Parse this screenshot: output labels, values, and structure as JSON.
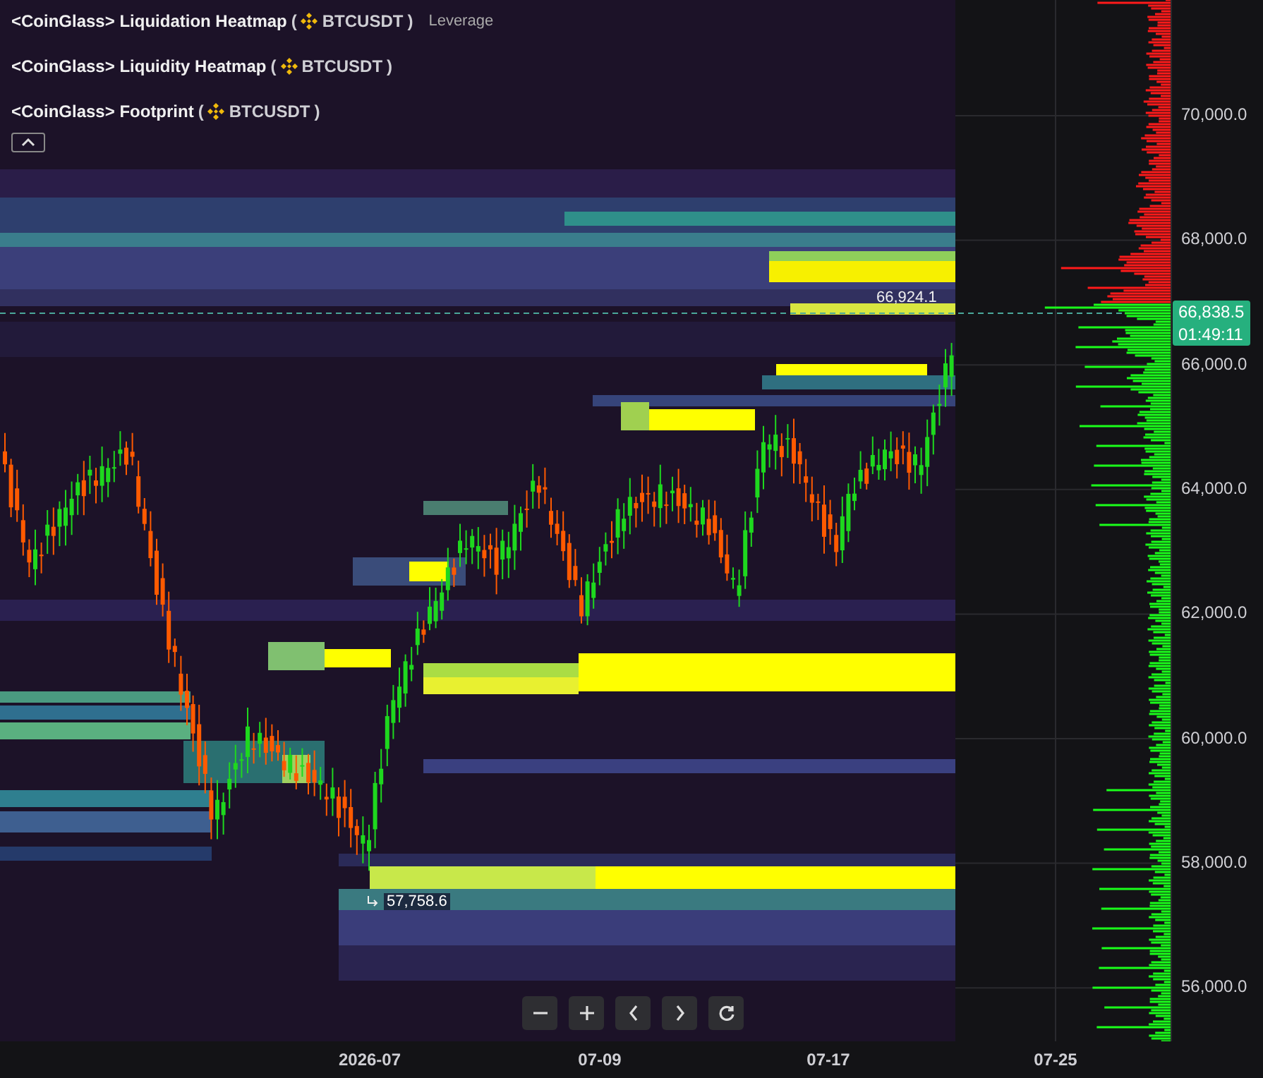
{
  "legend": [
    {
      "prefix": "<CoinGlass>",
      "title": "Liquidation Heatmap",
      "open_paren": "(",
      "symbol": "BTCUSDT",
      "close_paren": ")",
      "extra": "Leverage"
    },
    {
      "prefix": "<CoinGlass>",
      "title": "Liquidity Heatmap",
      "open_paren": "(",
      "symbol": "BTCUSDT",
      "close_paren": ")"
    },
    {
      "prefix": "<CoinGlass>",
      "title": "Footprint",
      "open_paren": "(",
      "symbol": "BTCUSDT",
      "close_paren": ")"
    }
  ],
  "price_axis": [
    "70,000.0",
    "68,000.0",
    "66,000.0",
    "64,000.0",
    "62,000.0",
    "60,000.0",
    "58,000.0",
    "56,000.0"
  ],
  "last_price": "66,838.5",
  "countdown": "01:49:11",
  "high_marker": "66,924.1",
  "low_marker": "57,758.6",
  "time_axis": [
    "2026-07",
    "07-09",
    "07-17",
    "07-25"
  ],
  "controls": [
    {
      "kind": "zoom-out"
    },
    {
      "kind": "zoom-in"
    },
    {
      "kind": "left"
    },
    {
      "kind": "right"
    },
    {
      "kind": "reset"
    }
  ]
}
